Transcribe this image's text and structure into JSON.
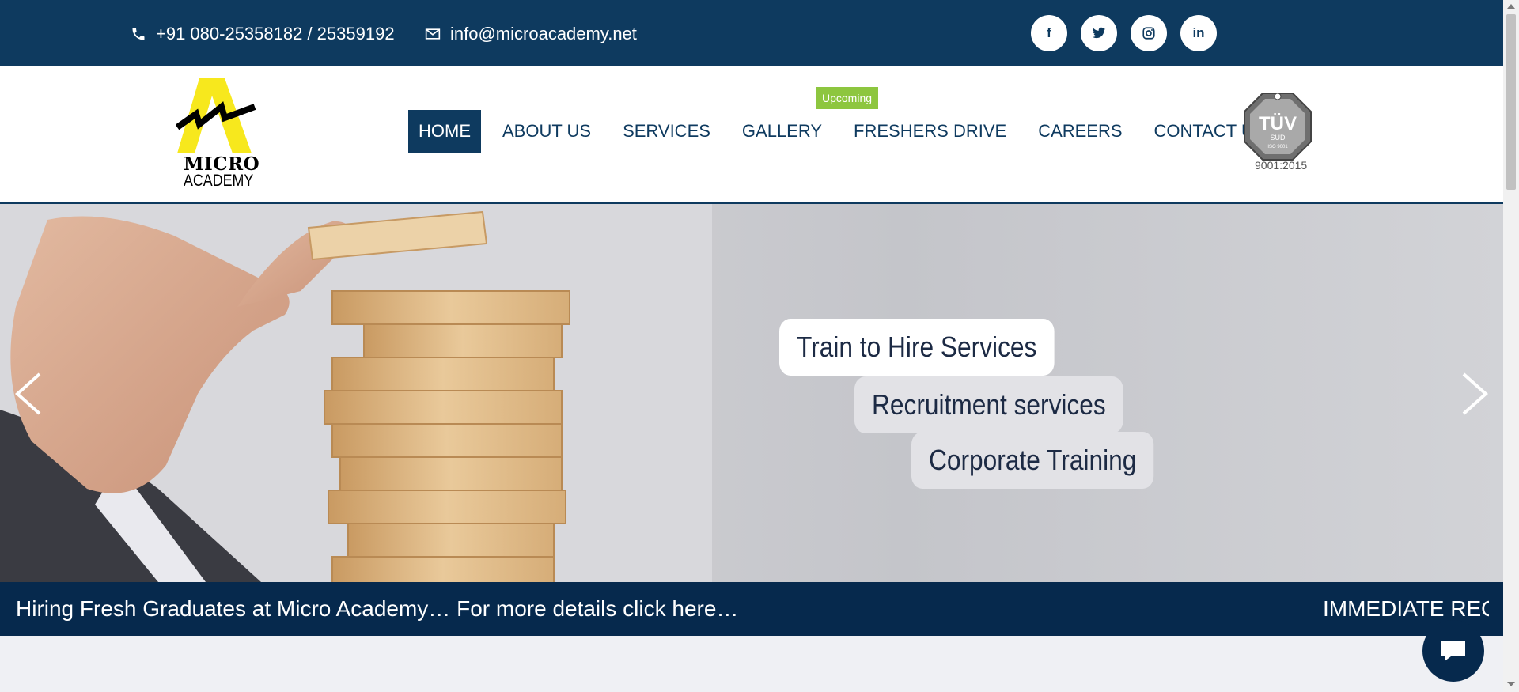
{
  "topbar": {
    "phone": "+91 080-25358182 / 25359192",
    "email": "info@microacademy.net",
    "socials": [
      {
        "icon": "facebook-icon",
        "glyph": "f"
      },
      {
        "icon": "twitter-icon"
      },
      {
        "icon": "instagram-icon"
      },
      {
        "icon": "linkedin-icon",
        "glyph": "in"
      }
    ]
  },
  "logo": {
    "line1": "MICRO",
    "line2": "ACADEMY",
    "color": "#f7e81d"
  },
  "nav": {
    "items": [
      "HOME",
      "ABOUT US",
      "SERVICES",
      "GALLERY",
      "FRESHERS DRIVE",
      "CAREERS",
      "CONTACT US"
    ],
    "active": "HOME",
    "badge": "Upcoming"
  },
  "certification": {
    "top": "TÜV",
    "sub": "SÜD",
    "iso": "ISO 9001",
    "label": "9001:2015"
  },
  "hero": {
    "pills": [
      "Train to Hire Services",
      "Recruitment services",
      "Corporate Training"
    ]
  },
  "ticker": {
    "primary": "Hiring Fresh Graduates at Micro Academy… For more details click here…",
    "secondary": "IMMEDIATE REQUIREMENT"
  },
  "colors": {
    "primary": "#0e3a5f",
    "dark": "#06294d",
    "badge": "#8dc63f"
  }
}
